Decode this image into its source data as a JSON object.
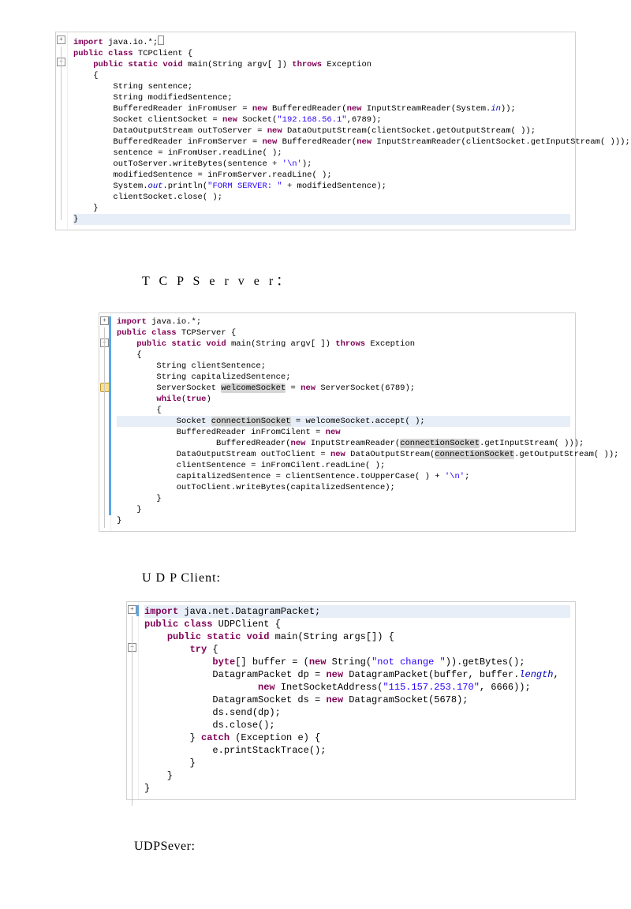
{
  "panel1": {
    "lines": [
      {
        "parts": [
          {
            "cls": "kw",
            "t": "import"
          },
          {
            "t": " java.io.*;"
          }
        ],
        "prefix": "",
        "suffix_box": true
      },
      {
        "parts": [
          {
            "cls": "kw",
            "t": "public class"
          },
          {
            "t": " TCPClient {"
          }
        ]
      },
      {
        "parts": [
          {
            "t": "    "
          },
          {
            "cls": "kw",
            "t": "public static void"
          },
          {
            "t": " main(String argv[ ]) "
          },
          {
            "cls": "kw",
            "t": "throws"
          },
          {
            "t": " Exception"
          }
        ]
      },
      {
        "parts": [
          {
            "t": "    {"
          }
        ]
      },
      {
        "parts": [
          {
            "t": "        String sentence;"
          }
        ]
      },
      {
        "parts": [
          {
            "t": "        String modifiedSentence;"
          }
        ]
      },
      {
        "parts": [
          {
            "t": "        BufferedReader inFromUser = "
          },
          {
            "cls": "kw",
            "t": "new"
          },
          {
            "t": " BufferedReader("
          },
          {
            "cls": "kw",
            "t": "new"
          },
          {
            "t": " InputStreamReader(System."
          },
          {
            "cls": "fld",
            "t": "in"
          },
          {
            "t": "));"
          }
        ]
      },
      {
        "parts": [
          {
            "t": "        Socket clientSocket = "
          },
          {
            "cls": "kw",
            "t": "new"
          },
          {
            "t": " Socket("
          },
          {
            "cls": "str",
            "t": "\"192.168.56.1\""
          },
          {
            "t": ",6789);"
          }
        ]
      },
      {
        "parts": [
          {
            "t": "        DataOutputStream outToServer = "
          },
          {
            "cls": "kw",
            "t": "new"
          },
          {
            "t": " DataOutputStream(clientSocket.getOutputStream( ));"
          }
        ]
      },
      {
        "parts": [
          {
            "t": "        BufferedReader inFromServer = "
          },
          {
            "cls": "kw",
            "t": "new"
          },
          {
            "t": " BufferedReader("
          },
          {
            "cls": "kw",
            "t": "new"
          },
          {
            "t": " InputStreamReader(clientSocket.getInputStream( )));"
          }
        ]
      },
      {
        "parts": [
          {
            "t": "        sentence = inFromUser.readLine( );"
          }
        ]
      },
      {
        "parts": [
          {
            "t": "        outToServer.writeBytes(sentence + "
          },
          {
            "cls": "str",
            "t": "'\\n'"
          },
          {
            "t": ");"
          }
        ]
      },
      {
        "parts": [
          {
            "t": "        modifiedSentence = inFromServer.readLine( );"
          }
        ]
      },
      {
        "parts": [
          {
            "t": "        System."
          },
          {
            "cls": "fld",
            "t": "out"
          },
          {
            "t": ".println("
          },
          {
            "cls": "str",
            "t": "\"FORM SERVER: \""
          },
          {
            "t": " + modifiedSentence);"
          }
        ]
      },
      {
        "parts": [
          {
            "t": "        clientSocket.close( );"
          }
        ]
      },
      {
        "parts": [
          {
            "t": "    }"
          }
        ]
      },
      {
        "parts": [
          {
            "t": ""
          }
        ]
      },
      {
        "hl": true,
        "parts": [
          {
            "t": "}"
          }
        ],
        "caret": true
      }
    ]
  },
  "heading1": "T C P S e r v e r：",
  "panel2": {
    "lines": [
      {
        "parts": [
          {
            "cls": "kw",
            "t": "import"
          },
          {
            "t": " java.io.*;"
          }
        ]
      },
      {
        "parts": [
          {
            "cls": "kw",
            "t": "public class"
          },
          {
            "t": " TCPServer {"
          }
        ]
      },
      {
        "parts": [
          {
            "t": "    "
          },
          {
            "cls": "kw",
            "t": "public static void"
          },
          {
            "t": " main(String argv[ ]) "
          },
          {
            "cls": "kw",
            "t": "throws"
          },
          {
            "t": " Exception"
          }
        ]
      },
      {
        "parts": [
          {
            "t": "    {"
          }
        ]
      },
      {
        "parts": [
          {
            "t": "        String clientSentence;"
          }
        ]
      },
      {
        "parts": [
          {
            "t": "        String capitalizedSentence;"
          }
        ]
      },
      {
        "parts": [
          {
            "t": "        ServerSocket "
          },
          {
            "cls": "id-hl",
            "t": "welcomeSocket"
          },
          {
            "t": " = "
          },
          {
            "cls": "kw",
            "t": "new"
          },
          {
            "t": " ServerSocket(6789);"
          }
        ]
      },
      {
        "parts": [
          {
            "t": "        "
          },
          {
            "cls": "kw",
            "t": "while"
          },
          {
            "t": "("
          },
          {
            "cls": "kw",
            "t": "true"
          },
          {
            "t": ")"
          }
        ]
      },
      {
        "parts": [
          {
            "t": "        {"
          }
        ]
      },
      {
        "hl": true,
        "parts": [
          {
            "t": "            Socket "
          },
          {
            "cls": "id-hl",
            "t": "connectionSocket"
          },
          {
            "t": " = welcomeSocket.accept( );"
          }
        ]
      },
      {
        "parts": [
          {
            "t": "            BufferedReader inFromCilent = "
          },
          {
            "cls": "kw",
            "t": "new"
          }
        ]
      },
      {
        "parts": [
          {
            "t": "                    BufferedReader("
          },
          {
            "cls": "kw",
            "t": "new"
          },
          {
            "t": " InputStreamReader("
          },
          {
            "cls": "id-hl",
            "t": "connectionSocket"
          },
          {
            "t": ".getInputStream( )));"
          }
        ]
      },
      {
        "parts": [
          {
            "t": "            DataOutputStream outToClient = "
          },
          {
            "cls": "kw",
            "t": "new"
          },
          {
            "t": " DataOutputStream("
          },
          {
            "cls": "id-hl",
            "t": "connectionSocket"
          },
          {
            "t": ".getOutputStream( ));"
          }
        ]
      },
      {
        "parts": [
          {
            "t": "            clientSentence = inFromCilent.readLine( );"
          }
        ]
      },
      {
        "parts": [
          {
            "t": "            capitalizedSentence = clientSentence.toUpperCase( ) + "
          },
          {
            "cls": "str",
            "t": "'\\n'"
          },
          {
            "t": ";"
          }
        ]
      },
      {
        "parts": [
          {
            "t": "            outToClient.writeBytes(capitalizedSentence);"
          }
        ]
      },
      {
        "parts": [
          {
            "t": "        }"
          }
        ]
      },
      {
        "parts": [
          {
            "t": "    }"
          }
        ]
      },
      {
        "parts": [
          {
            "t": ""
          }
        ]
      },
      {
        "parts": [
          {
            "t": "}"
          }
        ]
      }
    ]
  },
  "heading2": "U D P Client:",
  "panel3": {
    "lines": [
      {
        "hl": true,
        "parts": [
          {
            "cls": "kw",
            "t": "import"
          },
          {
            "t": " java.net.DatagramPacket;"
          }
        ]
      },
      {
        "parts": [
          {
            "t": ""
          }
        ]
      },
      {
        "parts": [
          {
            "cls": "kw",
            "t": "public class"
          },
          {
            "t": " UDPClient {"
          }
        ]
      },
      {
        "parts": [
          {
            "t": "    "
          },
          {
            "cls": "kw",
            "t": "public static void"
          },
          {
            "t": " main(String args[]) {"
          }
        ]
      },
      {
        "parts": [
          {
            "t": "        "
          },
          {
            "cls": "kw",
            "t": "try"
          },
          {
            "t": " {"
          }
        ]
      },
      {
        "parts": [
          {
            "t": "            "
          },
          {
            "cls": "kw",
            "t": "byte"
          },
          {
            "t": "[] buffer = ("
          },
          {
            "cls": "kw",
            "t": "new"
          },
          {
            "t": " String("
          },
          {
            "cls": "str",
            "t": "\"not change \""
          },
          {
            "t": ")).getBytes();"
          }
        ]
      },
      {
        "parts": [
          {
            "t": "            DatagramPacket dp = "
          },
          {
            "cls": "kw",
            "t": "new"
          },
          {
            "t": " DatagramPacket(buffer, buffer."
          },
          {
            "cls": "fld",
            "t": "length"
          },
          {
            "t": ","
          }
        ]
      },
      {
        "parts": [
          {
            "t": "                    "
          },
          {
            "cls": "kw",
            "t": "new"
          },
          {
            "t": " InetSocketAddress("
          },
          {
            "cls": "str",
            "t": "\"115.157.253.170\""
          },
          {
            "t": ", 6666));"
          }
        ]
      },
      {
        "parts": [
          {
            "t": "            DatagramSocket ds = "
          },
          {
            "cls": "kw",
            "t": "new"
          },
          {
            "t": " DatagramSocket(5678);"
          }
        ]
      },
      {
        "parts": [
          {
            "t": "            ds.send(dp);"
          }
        ]
      },
      {
        "parts": [
          {
            "t": "            ds.close();"
          }
        ]
      },
      {
        "parts": [
          {
            "t": "        } "
          },
          {
            "cls": "kw",
            "t": "catch"
          },
          {
            "t": " (Exception e) {"
          }
        ]
      },
      {
        "parts": [
          {
            "t": "            e.printStackTrace();"
          }
        ]
      },
      {
        "parts": [
          {
            "t": "        }"
          }
        ]
      },
      {
        "parts": [
          {
            "t": "    }"
          }
        ]
      },
      {
        "parts": [
          {
            "t": "}"
          }
        ]
      }
    ]
  },
  "heading3": "UDPSever:"
}
